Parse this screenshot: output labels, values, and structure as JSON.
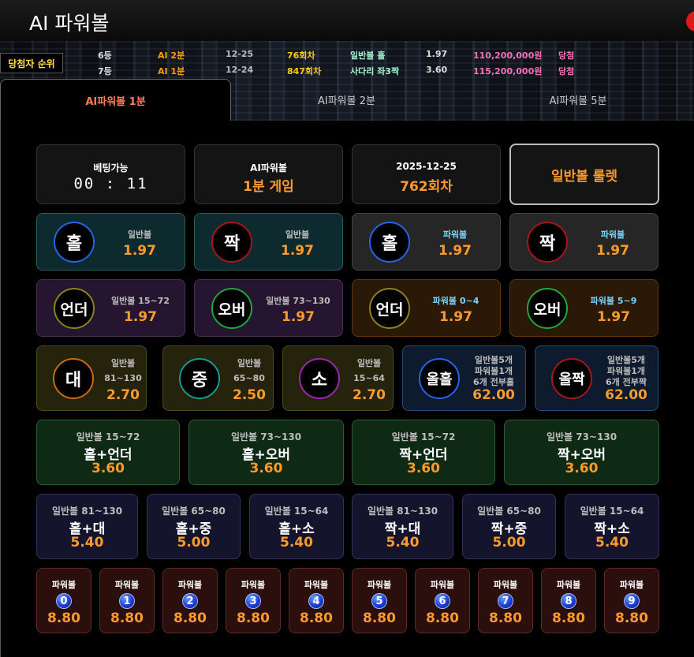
{
  "app": {
    "title": "AI 파워볼"
  },
  "winner_label": "당첨자 순위",
  "ticker": [
    {
      "rank": "6등",
      "game": "AI 2분",
      "date": "12-25",
      "round": "76회차",
      "pick": "일반볼 홀",
      "odds": "1.97",
      "amount": "110,200,000원",
      "result": "당첨"
    },
    {
      "rank": "7등",
      "game": "AI 1분",
      "date": "12-24",
      "round": "847회차",
      "pick": "사다리 좌3짝",
      "odds": "3.60",
      "amount": "115,200,000원",
      "result": "당첨"
    }
  ],
  "tabs": [
    "AI파워볼 1분",
    "AI파워볼 2분",
    "AI파워볼 5분"
  ],
  "info": {
    "bet_status": "베팅가능",
    "timer": "00 : 11",
    "game_name": "AI파워볼",
    "game_type": "1분 게임",
    "date": "2025-12-25",
    "round": "762회차",
    "roulette": "일반볼 룰렛"
  },
  "row_oe": [
    {
      "glyph": "홀",
      "label": "일반볼",
      "odds": "1.97"
    },
    {
      "glyph": "짝",
      "label": "일반볼",
      "odds": "1.97"
    },
    {
      "glyph": "홀",
      "label": "파워볼",
      "odds": "1.97"
    },
    {
      "glyph": "짝",
      "label": "파워볼",
      "odds": "1.97"
    }
  ],
  "row_uo": [
    {
      "glyph": "언더",
      "label": "일반볼 15~72",
      "odds": "1.97"
    },
    {
      "glyph": "오버",
      "label": "일반볼 73~130",
      "odds": "1.97"
    },
    {
      "glyph": "언더",
      "label": "파워볼 0~4",
      "odds": "1.97"
    },
    {
      "glyph": "오버",
      "label": "파워볼 5~9",
      "odds": "1.97"
    }
  ],
  "row_size": [
    {
      "glyph": "대",
      "label1": "일반볼",
      "label2": "81~130",
      "odds": "2.70"
    },
    {
      "glyph": "중",
      "label1": "일반볼",
      "label2": "65~80",
      "odds": "2.50"
    },
    {
      "glyph": "소",
      "label1": "일반볼",
      "label2": "15~64",
      "odds": "2.70"
    }
  ],
  "row_all": [
    {
      "glyph": "올홀",
      "label1": "일반볼5개",
      "label2": "파워볼1개",
      "label3": "6개 전부홀",
      "odds": "62.00"
    },
    {
      "glyph": "올짝",
      "label1": "일반볼5개",
      "label2": "파워볼1개",
      "label3": "6개 전부짝",
      "odds": "62.00"
    }
  ],
  "row_combo1": [
    {
      "label": "일반볼 15~72",
      "name": "홀+언더",
      "odds": "3.60"
    },
    {
      "label": "일반볼 73~130",
      "name": "홀+오버",
      "odds": "3.60"
    },
    {
      "label": "일반볼 15~72",
      "name": "짝+언더",
      "odds": "3.60"
    },
    {
      "label": "일반볼 73~130",
      "name": "짝+오버",
      "odds": "3.60"
    }
  ],
  "row_combo2": [
    {
      "label": "일반볼 81~130",
      "name": "홀+대",
      "odds": "5.40"
    },
    {
      "label": "일반볼 65~80",
      "name": "홀+중",
      "odds": "5.00"
    },
    {
      "label": "일반볼 15~64",
      "name": "홀+소",
      "odds": "5.40"
    },
    {
      "label": "일반볼 81~130",
      "name": "짝+대",
      "odds": "5.40"
    },
    {
      "label": "일반볼 65~80",
      "name": "짝+중",
      "odds": "5.00"
    },
    {
      "label": "일반볼 15~64",
      "name": "짝+소",
      "odds": "5.40"
    }
  ],
  "row_powerball": [
    {
      "label": "파워볼",
      "num": "0",
      "odds": "8.80"
    },
    {
      "label": "파워볼",
      "num": "1",
      "odds": "8.80"
    },
    {
      "label": "파워볼",
      "num": "2",
      "odds": "8.80"
    },
    {
      "label": "파워볼",
      "num": "3",
      "odds": "8.80"
    },
    {
      "label": "파워볼",
      "num": "4",
      "odds": "8.80"
    },
    {
      "label": "파워볼",
      "num": "5",
      "odds": "8.80"
    },
    {
      "label": "파워볼",
      "num": "6",
      "odds": "8.80"
    },
    {
      "label": "파워볼",
      "num": "7",
      "odds": "8.80"
    },
    {
      "label": "파워볼",
      "num": "8",
      "odds": "8.80"
    },
    {
      "label": "파워볼",
      "num": "9",
      "odds": "8.80"
    }
  ]
}
